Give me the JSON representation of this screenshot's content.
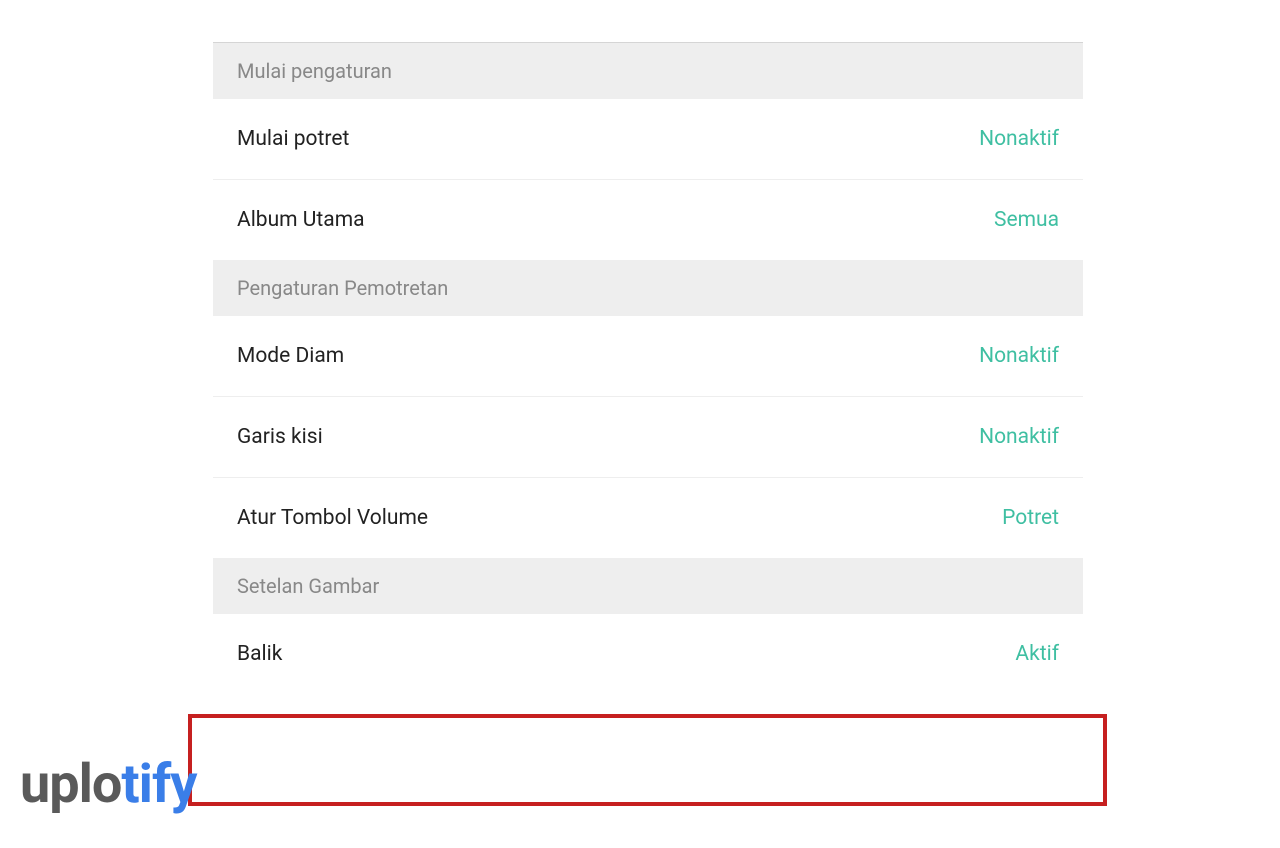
{
  "sections": [
    {
      "header": "Mulai pengaturan",
      "rows": [
        {
          "label": "Mulai potret",
          "value": "Nonaktif"
        },
        {
          "label": "Album Utama",
          "value": "Semua"
        }
      ]
    },
    {
      "header": "Pengaturan Pemotretan",
      "rows": [
        {
          "label": "Mode Diam",
          "value": "Nonaktif"
        },
        {
          "label": "Garis kisi",
          "value": "Nonaktif"
        },
        {
          "label": "Atur Tombol Volume",
          "value": "Potret"
        }
      ]
    },
    {
      "header": "Setelan Gambar",
      "rows": [
        {
          "label": "Balik",
          "value": "Aktif"
        }
      ]
    }
  ],
  "watermark": {
    "part1": "uplo",
    "part2": "tify"
  }
}
